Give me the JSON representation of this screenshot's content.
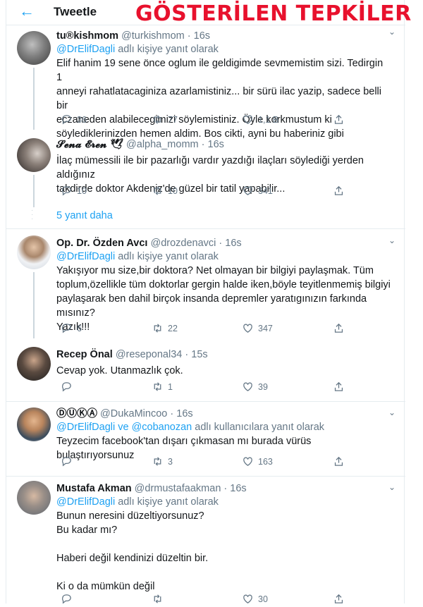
{
  "header": {
    "back_icon": "arrow-left-icon",
    "title": "Tweetle",
    "overlay": "GÖSTERİLEN TEPKİLER"
  },
  "colors": {
    "accent": "#1da1f2",
    "overlay": "#e8112d"
  },
  "more_replies": "5 yanıt daha",
  "tweets": [
    {
      "name": "tu®kishmom",
      "handle": "@turkishmom",
      "time": "16s",
      "reply_prefix": "",
      "reply_to": "@DrElifDagli",
      "reply_suffix": " adlı kişiye yanıt olarak",
      "lines": [
        "Elif hanim 19 sene önce oglum ile geldigimde sevmemistim sizi. Tedirgin 1",
        "anneyi rahatlatacaginiza azarlamistiniz... bir sürü ilac yazip, sadece belli bir",
        "eczaneden alabilecegimizi söylemistiniz. Öyle korkmustum ki",
        "söylediklerinizden hemen aldim. Bos cikti, ayni bu haberiniz gibi"
      ],
      "replies": "36",
      "retweets": "77",
      "likes": "1,1 B"
    },
    {
      "name": "𝓢𝓮𝓷𝓪 𝓔𝓻𝓮𝓷 🕊",
      "handle": "@alpha_momm",
      "time": "16s",
      "reply_prefix": "",
      "reply_to": "",
      "reply_suffix": "",
      "lines": [
        "İlaç mümessili ile bir pazarlığı vardır yazdığı ilaçları söylediği yerden aldığınız",
        "takdirde doktor Akdeniz'de güzel bir tatil yapabilir..."
      ],
      "replies": "10",
      "retweets": "10",
      "likes": "341"
    },
    {
      "name": "Op. Dr. Özden Avcı",
      "handle": "@drozdenavci",
      "time": "16s",
      "reply_prefix": "",
      "reply_to": "@DrElifDagli",
      "reply_suffix": " adlı kişiye yanıt olarak",
      "lines": [
        "Yakışıyor mu size,bir doktora? Net olmayan bir bilgiyi paylaşmak. Tüm",
        "toplum,özellikle tüm doktorlar gergin halde iken,böyle teyitlenmemiş bilgiyi",
        "paylaşarak ben dahil birçok insanda depremler yaratıgınızın farkında mısınız?",
        "Yazık!!!"
      ],
      "replies": "6",
      "retweets": "22",
      "likes": "347"
    },
    {
      "name": "Recep Önal",
      "handle": "@reseponal34",
      "time": "15s",
      "reply_prefix": "",
      "reply_to": "",
      "reply_suffix": "",
      "lines": [
        "Cevap yok. Utanmazlık çok."
      ],
      "replies": "",
      "retweets": "1",
      "likes": "39"
    },
    {
      "name": "ⒹⓊⓀⒶ",
      "handle": "@DukaMincoo",
      "time": "16s",
      "reply_prefix": "",
      "reply_to": "@DrElifDagli ve @cobanozan",
      "reply_suffix": " adlı kullanıcılara yanıt olarak",
      "lines": [
        "Teyzecim facebook'tan dışarı çıkmasan mı burada vürüs bulaştırıyorsunuz"
      ],
      "replies": "",
      "retweets": "3",
      "likes": "163"
    },
    {
      "name": "Mustafa Akman",
      "handle": "@drmustafaakman",
      "time": "16s",
      "reply_prefix": "",
      "reply_to": "@DrElifDagli",
      "reply_suffix": " adlı kişiye yanıt olarak",
      "lines": [
        "Bunun neresini düzeltiyorsunuz?",
        "Bu kadar mı?",
        "",
        "Haberi değil kendinizi düzeltin bir.",
        "",
        "Ki o da mümkün değil"
      ],
      "replies": "",
      "retweets": "",
      "likes": "30"
    }
  ]
}
